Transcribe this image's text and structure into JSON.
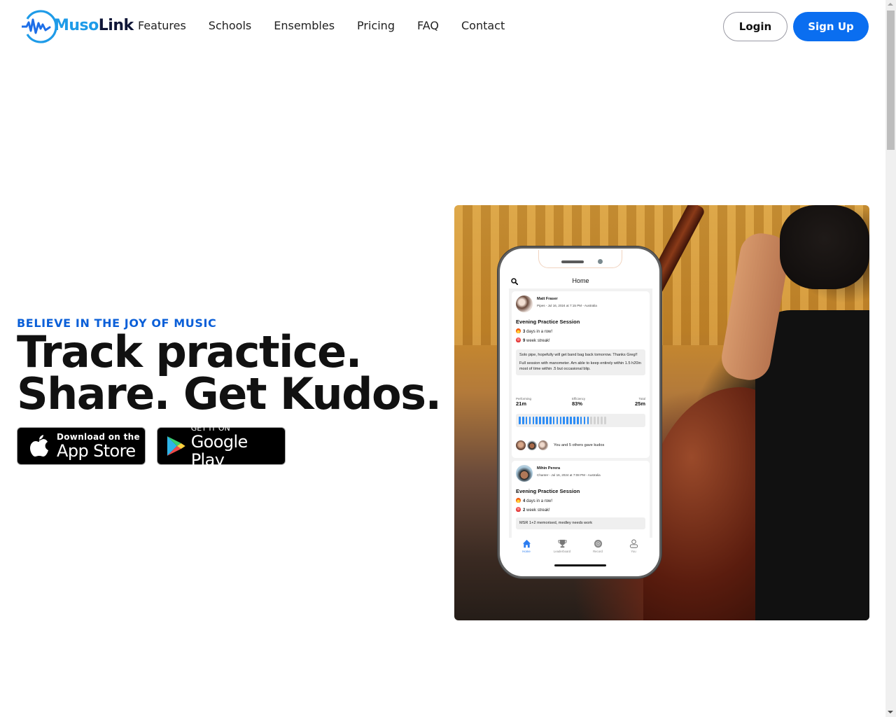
{
  "header": {
    "logo": {
      "part1": "Muso",
      "part2": "Link"
    },
    "nav": [
      "Features",
      "Schools",
      "Ensembles",
      "Pricing",
      "FAQ",
      "Contact"
    ],
    "login_label": "Login",
    "signup_label": "Sign Up"
  },
  "colors": {
    "brand_blue": "#0a6ef0",
    "eyebrow_blue": "#0a5fd8",
    "logo_cyan": "#1e9be8",
    "logo_navy": "#0f1637",
    "progress_blue": "#2c8cf5"
  },
  "hero": {
    "eyebrow": "BELIEVE IN THE JOY OF MUSIC",
    "headline_line1": "Track practice.",
    "headline_line2": "Share. Get Kudos.",
    "appstore": {
      "small": "Download on the",
      "big": "App Store",
      "icon": "apple-icon"
    },
    "googleplay": {
      "small": "GET IT ON",
      "big": "Google Play",
      "icon": "google-play-icon"
    }
  },
  "phone": {
    "screen_title": "Home",
    "posts": [
      {
        "name": "Matt Fraser",
        "meta": "Pipes - Jul 16, 2024 at 7:15 PM - Australia",
        "title": "Evening Practice Session",
        "days_count": "3",
        "days_text": "days in a row!",
        "weeks_count": "9",
        "weeks_text": "week streak!",
        "notes": [
          "Solo pipe, hopefully will get band bag back tomorrow. Thanks Greg!!",
          "Full session with manometer. Am able to keep entirely within 1.5 h20in most of time within .5 but occasional blip."
        ],
        "stats": [
          {
            "label": "Performing",
            "value": "21m"
          },
          {
            "label": "Efficiency",
            "value": "83%"
          },
          {
            "label": "Total",
            "value": "25m"
          }
        ],
        "progress": {
          "filled_segments": 21,
          "total_segments": 26
        },
        "kudos_text": "You and 5 others gave kudos"
      },
      {
        "name": "Mihin Perera",
        "meta": "Chanter - Jul 16, 2024 at 7:08 PM - Australia",
        "title": "Evening Practice Session",
        "days_count": "4",
        "days_text": "days in a row!",
        "weeks_count": "2",
        "weeks_text": "week streak!",
        "notes": [
          "MSR 1+2 memorised, medley needs work"
        ]
      }
    ],
    "tabs": [
      {
        "label": "Home",
        "icon": "home-icon",
        "active": true
      },
      {
        "label": "Leaderboard",
        "icon": "trophy-icon",
        "active": false
      },
      {
        "label": "Record",
        "icon": "record-icon",
        "active": false
      },
      {
        "label": "You",
        "icon": "user-icon",
        "active": false
      }
    ]
  }
}
